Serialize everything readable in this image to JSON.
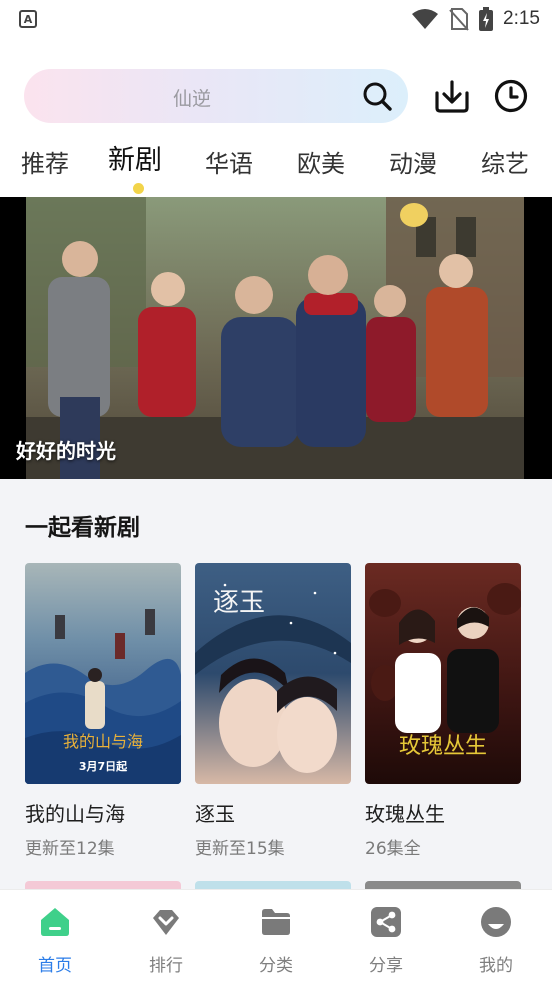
{
  "status_bar": {
    "app_icon_letter": "A",
    "time": "2:15",
    "icons": [
      "wifi-icon",
      "no-sim-icon",
      "battery-charging-icon"
    ]
  },
  "search": {
    "placeholder": "仙逆",
    "icons": [
      "search-icon",
      "download-icon",
      "history-icon"
    ]
  },
  "tabs": [
    {
      "label": "推荐"
    },
    {
      "label": "新剧"
    },
    {
      "label": "华语"
    },
    {
      "label": "欧美"
    },
    {
      "label": "动漫"
    },
    {
      "label": "综艺"
    }
  ],
  "active_tab": "新剧",
  "banner": {
    "caption": "好好的时光"
  },
  "section": {
    "title": "一起看新剧",
    "items": [
      {
        "title": "我的山与海",
        "subtitle": "更新至12集",
        "poster_text": "我的山与海",
        "poster_date": "3月7日起"
      },
      {
        "title": "逐玉",
        "subtitle": "更新至15集",
        "poster_text": "逐玉"
      },
      {
        "title": "玫瑰丛生",
        "subtitle": "26集全",
        "poster_text": "玫瑰丛生"
      }
    ]
  },
  "bottom_nav": {
    "items": [
      {
        "label": "首页",
        "icon": "home-icon",
        "active": true
      },
      {
        "label": "排行",
        "icon": "ranking-icon"
      },
      {
        "label": "分类",
        "icon": "folder-icon"
      },
      {
        "label": "分享",
        "icon": "share-icon"
      },
      {
        "label": "我的",
        "icon": "profile-icon"
      }
    ]
  },
  "colors": {
    "accent": "#2c7de8",
    "tab_indicator": "#f2d44a",
    "home_icon": "#3fd08a",
    "section_bg": "#f3f4f7"
  }
}
